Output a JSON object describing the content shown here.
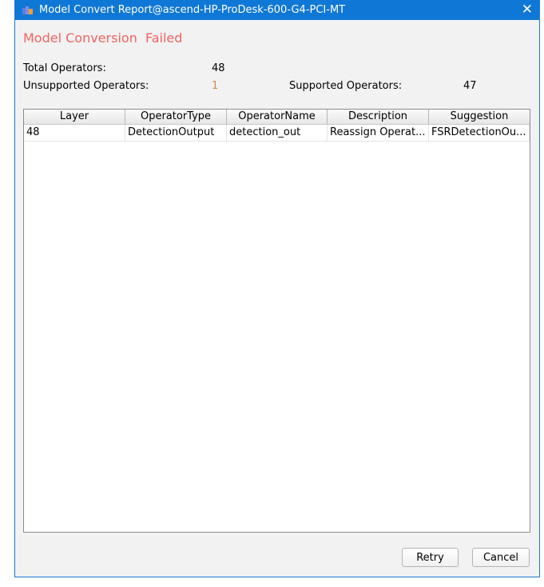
{
  "window": {
    "title": "Model Convert Report@ascend-HP-ProDesk-600-G4-PCI-MT",
    "close_icon": "close-icon",
    "accent": "#0f78d6"
  },
  "heading": "Model Conversion  Failed",
  "stats": {
    "total_label": "Total Operators:",
    "total_value": "48",
    "unsupported_label": "Unsupported Operators:",
    "unsupported_value": "1",
    "supported_label": "Supported Operators:",
    "supported_value": "47"
  },
  "table": {
    "columns": [
      "Layer",
      "OperatorType",
      "OperatorName",
      "Description",
      "Suggestion"
    ],
    "rows": [
      [
        "48",
        "DetectionOutput",
        "detection_out",
        "Reassign Operat...",
        "FSRDetectionOu..."
      ]
    ]
  },
  "buttons": {
    "retry": "Retry",
    "cancel": "Cancel"
  }
}
